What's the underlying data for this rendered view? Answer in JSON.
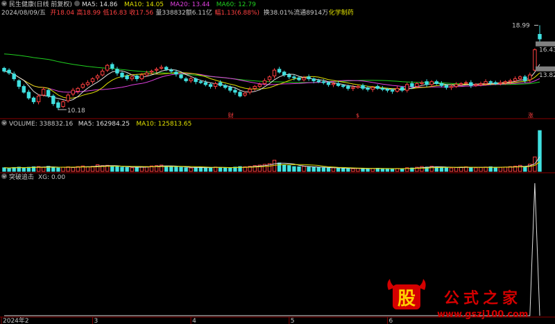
{
  "header": {
    "stock_name": "民生健康(日线 前复权)",
    "ma_items": [
      {
        "label": "MA5: 14.86",
        "color": "#e0e0e0"
      },
      {
        "label": "MA10: 14.05",
        "color": "#e0e000"
      },
      {
        "label": "MA20: 13.44",
        "color": "#e040e0"
      },
      {
        "label": "MA60: 12.79",
        "color": "#20d020"
      }
    ],
    "info_line": [
      {
        "text": "2024/08/09/五",
        "color": "#c8c8c8"
      },
      {
        "text": "开18.04",
        "color": "#ff4040"
      },
      {
        "text": "高18.99",
        "color": "#ff4040"
      },
      {
        "text": "低16.83",
        "color": "#ff4040"
      },
      {
        "text": "收17.56",
        "color": "#ff4040"
      },
      {
        "text": "量338832",
        "color": "#c8c8c8"
      },
      {
        "text": "额6.11亿",
        "color": "#c8c8c8"
      },
      {
        "text": "幅1.13(6.88%)",
        "color": "#ff4040"
      },
      {
        "text": "换38.01%",
        "color": "#c8c8c8"
      },
      {
        "text": "流通8914万",
        "color": "#c8c8c8"
      },
      {
        "text": "化学制药",
        "color": "#e0e000"
      }
    ]
  },
  "volume_header": [
    {
      "text": "VOLUME: 338832.16",
      "color": "#c8c8c8"
    },
    {
      "text": "MA5: 162984.25",
      "color": "#e0e0e0"
    },
    {
      "text": "MA10: 125813.65",
      "color": "#e0e000"
    }
  ],
  "indicator_header": [
    {
      "text": "突破追击",
      "color": "#c8c8c8"
    },
    {
      "text": "XG: 0.00",
      "color": "#c8c8c8"
    }
  ],
  "price_labels": {
    "high": "18.99",
    "low": "10.18",
    "right_upper": "16.43",
    "right_lower": "13.82"
  },
  "markers": [
    {
      "text": "财",
      "color": "#ff4040"
    },
    {
      "text": "$",
      "color": "#ff4040"
    },
    {
      "text": "涨",
      "color": "#ff4040"
    }
  ],
  "x_axis": {
    "labels": [
      "2024年2",
      "3",
      "4",
      "5",
      "6"
    ]
  },
  "watermark": {
    "logo_char": "股",
    "cn": "公式之家",
    "url": "www.gszj100.com"
  },
  "colors": {
    "up": "#ff4040",
    "down": "#40e0e0",
    "ma5": "#e0e0e0",
    "ma10": "#e0e000",
    "ma20": "#e040e0",
    "ma60": "#20d020"
  },
  "chart_data": [
    {
      "type": "candlestick",
      "title": "民生健康(日线 前复权)",
      "last_bar": {
        "date": "2024/08/09",
        "open": 18.04,
        "high": 18.99,
        "low": 16.83,
        "close": 17.56
      },
      "period_high": 18.99,
      "period_low": 10.18,
      "ylim": [
        9.6,
        19.6
      ],
      "ma_lines": [
        {
          "name": "MA5",
          "last": 14.86
        },
        {
          "name": "MA10",
          "last": 14.05
        },
        {
          "name": "MA20",
          "last": 13.44
        },
        {
          "name": "MA60",
          "last": 12.79
        }
      ],
      "closes": [
        14.2,
        14.0,
        13.4,
        12.6,
        12.0,
        11.4,
        11.0,
        11.6,
        12.3,
        11.6,
        10.8,
        10.4,
        11.0,
        11.7,
        12.2,
        12.4,
        12.8,
        13.0,
        13.4,
        13.7,
        14.2,
        14.8,
        14.5,
        14.0,
        13.6,
        13.4,
        13.6,
        13.4,
        13.8,
        14.0,
        14.2,
        14.4,
        14.6,
        14.4,
        14.2,
        13.9,
        13.5,
        13.2,
        13.4,
        13.1,
        13.0,
        12.8,
        12.6,
        12.9,
        12.7,
        12.5,
        12.2,
        12.0,
        11.6,
        11.9,
        12.3,
        12.6,
        12.8,
        13.2,
        13.6,
        14.3,
        14.1,
        13.8,
        13.6,
        13.5,
        13.3,
        13.5,
        13.4,
        13.2,
        13.1,
        13.0,
        12.8,
        12.9,
        12.7,
        12.6,
        12.4,
        12.5,
        12.6,
        12.4,
        12.3,
        12.5,
        12.4,
        12.3,
        12.2,
        12.1,
        12.4,
        12.2,
        12.8,
        12.6,
        12.9,
        13.0,
        12.8,
        13.1,
        12.9,
        12.7,
        12.5,
        12.6,
        12.8,
        12.9,
        13.0,
        12.7,
        12.8,
        12.9,
        13.1,
        13.0,
        12.9,
        13.0,
        13.1,
        13.2,
        13.4,
        13.6,
        13.2,
        13.8,
        16.43,
        17.56
      ],
      "opens": [
        14.5,
        14.3,
        13.9,
        13.2,
        12.6,
        12.0,
        11.4,
        11.0,
        11.7,
        12.2,
        11.6,
        10.9,
        10.5,
        11.1,
        11.8,
        12.1,
        12.5,
        12.8,
        13.1,
        13.5,
        13.8,
        14.3,
        14.9,
        14.4,
        14.0,
        13.7,
        13.4,
        13.7,
        13.4,
        13.8,
        14.1,
        14.3,
        14.5,
        14.6,
        14.3,
        14.1,
        13.8,
        13.4,
        13.2,
        13.4,
        13.1,
        13.0,
        12.8,
        12.6,
        13.0,
        12.7,
        12.5,
        12.2,
        12.0,
        11.7,
        12.0,
        12.4,
        12.6,
        12.9,
        13.3,
        13.7,
        14.4,
        14.1,
        13.8,
        13.6,
        13.5,
        13.3,
        13.6,
        13.4,
        13.2,
        13.1,
        13.0,
        12.8,
        12.9,
        12.7,
        12.6,
        12.4,
        12.5,
        12.7,
        12.4,
        12.3,
        12.6,
        12.4,
        12.3,
        12.2,
        12.1,
        12.5,
        12.2,
        12.9,
        12.6,
        12.9,
        13.1,
        12.8,
        13.1,
        12.9,
        12.7,
        12.5,
        12.6,
        12.8,
        13.0,
        13.0,
        12.7,
        12.8,
        12.9,
        13.1,
        13.0,
        12.9,
        13.0,
        13.1,
        13.2,
        13.4,
        13.6,
        13.3,
        14.3,
        18.04
      ],
      "volume_ma": [
        {
          "name": "MA5",
          "last": 162984.25
        },
        {
          "name": "MA10",
          "last": 125813.65
        }
      ],
      "volumes": [
        30,
        28,
        32,
        35,
        30,
        34,
        38,
        40,
        36,
        42,
        30,
        28,
        35,
        38,
        32,
        40,
        45,
        38,
        42,
        55,
        48,
        50,
        42,
        38,
        35,
        33,
        30,
        36,
        38,
        40,
        45,
        48,
        52,
        44,
        40,
        36,
        34,
        30,
        28,
        32,
        35,
        30,
        33,
        36,
        32,
        30,
        28,
        35,
        40,
        38,
        42,
        48,
        52,
        58,
        64,
        92,
        70,
        55,
        48,
        40,
        38,
        42,
        36,
        34,
        32,
        30,
        28,
        30,
        26,
        25,
        24,
        22,
        25,
        23,
        22,
        24,
        26,
        22,
        21,
        20,
        24,
        22,
        30,
        28,
        34,
        40,
        36,
        42,
        38,
        34,
        30,
        28,
        32,
        35,
        38,
        34,
        30,
        32,
        36,
        38,
        34,
        33,
        36,
        40,
        44,
        50,
        40,
        60,
        120,
        338.8
      ],
      "xg_signal": {
        "index": 108,
        "value": 1.0
      }
    }
  ]
}
